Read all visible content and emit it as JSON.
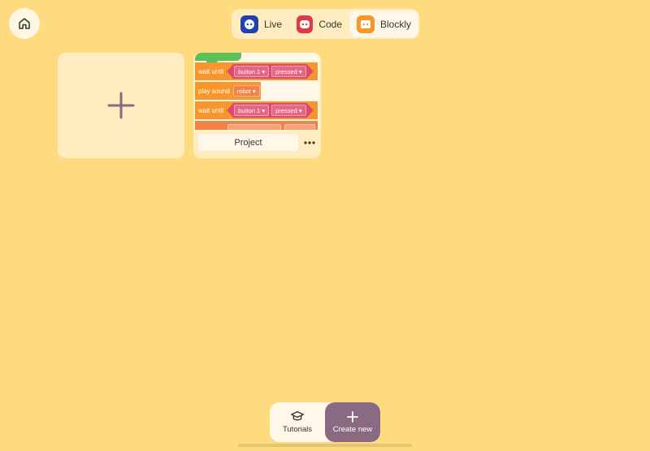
{
  "colors": {
    "background": "#FFDB80",
    "card": "#FFECC0",
    "accent_create": "#8A6A82",
    "live_icon": "#1F43A8",
    "code_icon": "#E03A4A",
    "blockly_icon": "#F7962A"
  },
  "header": {
    "home_icon": "house-icon",
    "modes": [
      {
        "label": "Live",
        "icon": "robot-live-icon"
      },
      {
        "label": "Code",
        "icon": "robot-code-icon"
      },
      {
        "label": "Blockly",
        "icon": "robot-blockly-icon",
        "selected": true
      }
    ]
  },
  "grid": {
    "add_card_icon": "plus-icon",
    "projects": [
      {
        "name": "Project",
        "more_icon": "ellipsis-icon",
        "preview_blocks": [
          {
            "label": "wait until",
            "options": [
              "button 1",
              "pressed"
            ]
          },
          {
            "label": "play sound",
            "options": [
              "robot"
            ]
          },
          {
            "label": "wait until",
            "options": [
              "button 1",
              "pressed"
            ]
          }
        ]
      }
    ]
  },
  "bottom": {
    "tutorials_label": "Tutorials",
    "tutorials_icon": "graduation-cap-icon",
    "create_label": "Create new",
    "create_icon": "plus-icon"
  }
}
